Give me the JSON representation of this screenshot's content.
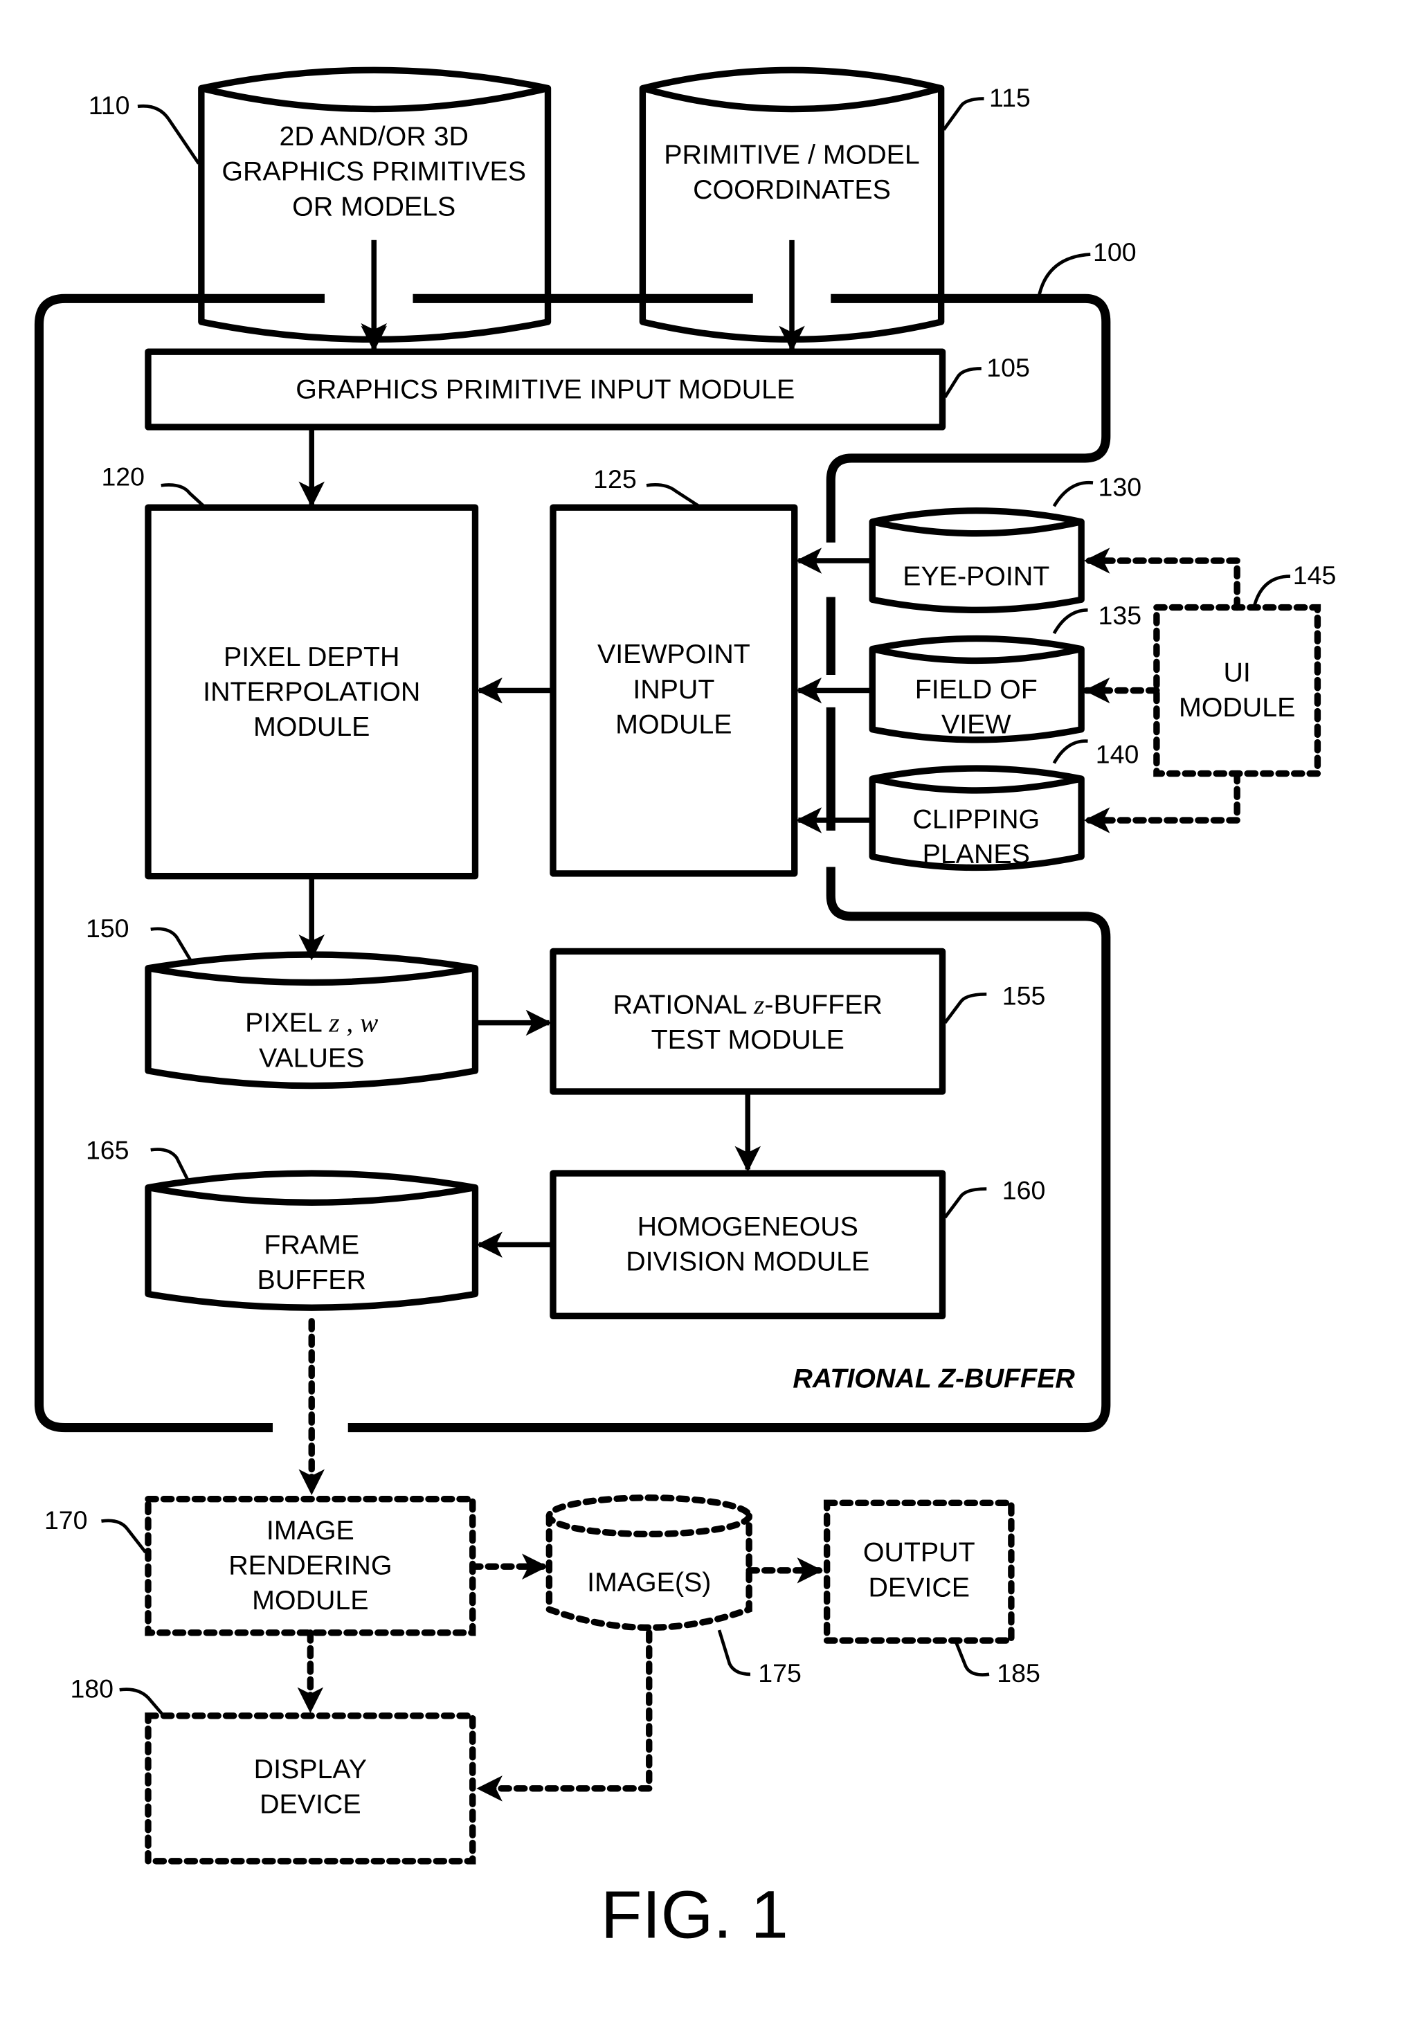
{
  "figure": {
    "caption": "FIG. 1",
    "container_label": "RATIONAL Z-BUFFER",
    "container_ref": "100"
  },
  "nodes": {
    "primitives_db": {
      "ref": "110",
      "lines": [
        "2D AND/OR 3D",
        "GRAPHICS PRIMITIVES",
        "OR MODELS"
      ]
    },
    "coords_db": {
      "ref": "115",
      "lines": [
        "PRIMITIVE / MODEL",
        "COORDINATES"
      ]
    },
    "input_module": {
      "ref": "105",
      "lines": [
        "GRAPHICS PRIMITIVE INPUT MODULE"
      ]
    },
    "depth_module": {
      "ref": "120",
      "lines": [
        "PIXEL DEPTH",
        "INTERPOLATION",
        "MODULE"
      ]
    },
    "viewpoint_module": {
      "ref": "125",
      "lines": [
        "VIEWPOINT",
        "INPUT",
        "MODULE"
      ]
    },
    "eyepoint_db": {
      "ref": "130",
      "lines": [
        "EYE-POINT"
      ]
    },
    "fov_db": {
      "ref": "135",
      "lines": [
        "FIELD OF",
        "VIEW"
      ]
    },
    "clipping_db": {
      "ref": "140",
      "lines": [
        "CLIPPING",
        "PLANES"
      ]
    },
    "ui_module": {
      "ref": "145",
      "lines": [
        "UI",
        "MODULE"
      ]
    },
    "pixel_values_db": {
      "ref": "150",
      "line1_prefix": "PIXEL ",
      "line1_math": "z , w",
      "line2": "VALUES"
    },
    "zbuffer_test": {
      "ref": "155",
      "line1_prefix": "RATIONAL ",
      "line1_math": "z",
      "line1_suffix": "-BUFFER",
      "line2": "TEST MODULE"
    },
    "homogeneous_div": {
      "ref": "160",
      "lines": [
        "HOMOGENEOUS",
        "DIVISION MODULE"
      ]
    },
    "frame_buffer_db": {
      "ref": "165",
      "lines": [
        "FRAME",
        "BUFFER"
      ]
    },
    "render_module": {
      "ref": "170",
      "lines": [
        "IMAGE",
        "RENDERING",
        "MODULE"
      ]
    },
    "images_db": {
      "ref": "175",
      "lines": [
        "IMAGE(S)"
      ]
    },
    "display_device": {
      "ref": "180",
      "lines": [
        "DISPLAY",
        "DEVICE"
      ]
    },
    "output_device": {
      "ref": "185",
      "lines": [
        "OUTPUT",
        "DEVICE"
      ]
    }
  }
}
